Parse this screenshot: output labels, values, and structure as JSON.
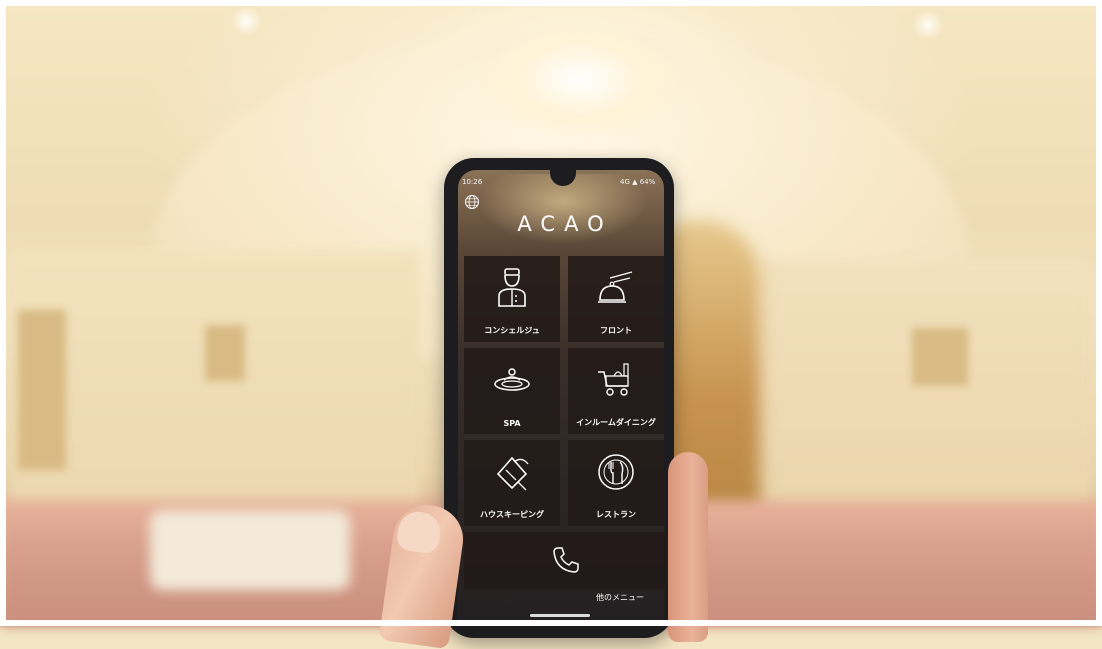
{
  "phone": {
    "status_time": "10:26",
    "status_right": "4G ▲ 64%",
    "brand": "ACAO",
    "tiles": [
      {
        "label": "コンシェルジュ",
        "icon": "concierge-icon"
      },
      {
        "label": "フロント",
        "icon": "cloche-bell-icon"
      },
      {
        "label": "SPA",
        "icon": "spa-icon"
      },
      {
        "label": "インルームダイニング",
        "icon": "room-service-cart-icon"
      },
      {
        "label": "ハウスキーピング",
        "icon": "housekeeping-cleaning-icon"
      },
      {
        "label": "レストラン",
        "icon": "fork-knife-plate-icon"
      }
    ],
    "call_icon": "phone-icon",
    "other_menu": "他のメニュー"
  },
  "colors": {
    "tile_bg": "#221a18",
    "tile_text": "#ffffff"
  }
}
